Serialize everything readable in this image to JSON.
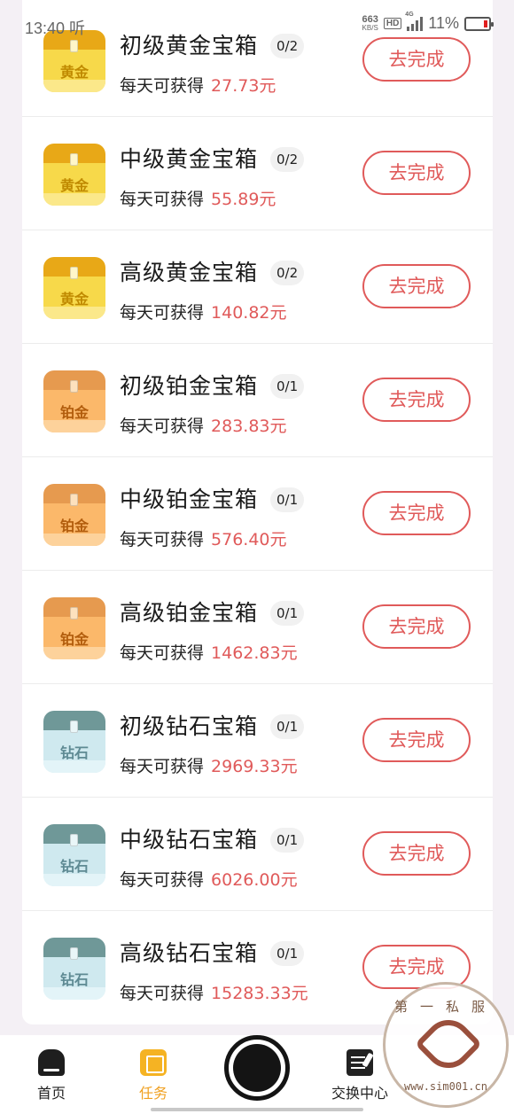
{
  "status_bar": {
    "time": "13:40 听",
    "net_speed": "663",
    "net_unit": "KB/S",
    "hd": "HD",
    "network": "4G",
    "battery_pct": "11%"
  },
  "action_label": "去完成",
  "daily_label": "每天可获得",
  "tasks": [
    {
      "title": "初级黄金宝箱",
      "progress": "0/2",
      "amount": "27.73元",
      "chest_label": "黄金",
      "tier": "gold"
    },
    {
      "title": "中级黄金宝箱",
      "progress": "0/2",
      "amount": "55.89元",
      "chest_label": "黄金",
      "tier": "gold"
    },
    {
      "title": "高级黄金宝箱",
      "progress": "0/2",
      "amount": "140.82元",
      "chest_label": "黄金",
      "tier": "gold"
    },
    {
      "title": "初级铂金宝箱",
      "progress": "0/1",
      "amount": "283.83元",
      "chest_label": "铂金",
      "tier": "platinum"
    },
    {
      "title": "中级铂金宝箱",
      "progress": "0/1",
      "amount": "576.40元",
      "chest_label": "铂金",
      "tier": "platinum"
    },
    {
      "title": "高级铂金宝箱",
      "progress": "0/1",
      "amount": "1462.83元",
      "chest_label": "铂金",
      "tier": "platinum"
    },
    {
      "title": "初级钻石宝箱",
      "progress": "0/1",
      "amount": "2969.33元",
      "chest_label": "钻石",
      "tier": "diamond"
    },
    {
      "title": "中级钻石宝箱",
      "progress": "0/1",
      "amount": "6026.00元",
      "chest_label": "钻石",
      "tier": "diamond"
    },
    {
      "title": "高级钻石宝箱",
      "progress": "0/1",
      "amount": "15283.33元",
      "chest_label": "钻石",
      "tier": "diamond"
    }
  ],
  "nav": {
    "home": {
      "label": "首页",
      "icon": "home-icon"
    },
    "tasks": {
      "label": "任务",
      "icon": "tasks-icon"
    },
    "exchange": {
      "label": "交换中心",
      "icon": "exchange-icon"
    },
    "active": "tasks"
  },
  "colors": {
    "accent": "#e05a5a",
    "active_nav": "#f0a020"
  },
  "watermark": {
    "top": "第一私服",
    "bottom": "www.sim001.cn"
  }
}
